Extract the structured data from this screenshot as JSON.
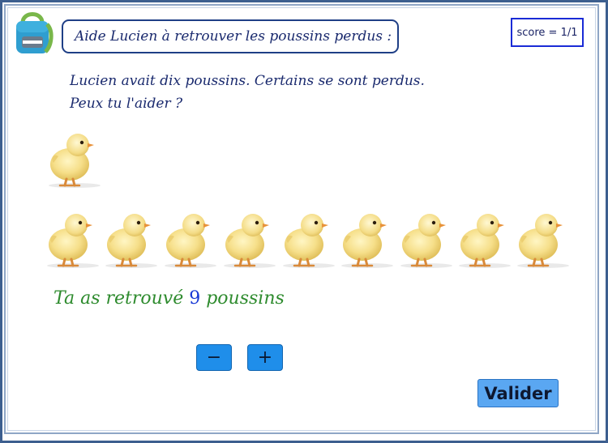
{
  "header": {
    "title": "Aide Lucien à retrouver les poussins perdus :",
    "score": "score = 1/1"
  },
  "instructions": {
    "line1": "Lucien avait dix poussins. Certains se sont perdus.",
    "line2": "Peux tu l'aider ?"
  },
  "chicks": {
    "top_row_count": 1,
    "bottom_row_count": 9
  },
  "result": {
    "prefix": "Ta as retrouvé ",
    "count": "9",
    "suffix": " poussins"
  },
  "controls": {
    "minus_label": "−",
    "plus_label": "+",
    "validate_label": "Valider"
  },
  "colors": {
    "title_text": "#1a2a6e",
    "result_text": "#2e8b2e",
    "result_number": "#1a3ad6",
    "button_blue": "#1f8eea",
    "validate_blue": "#5aa7f2"
  },
  "icons": {
    "logo": "backpack-icon",
    "chick": "chick-icon"
  }
}
